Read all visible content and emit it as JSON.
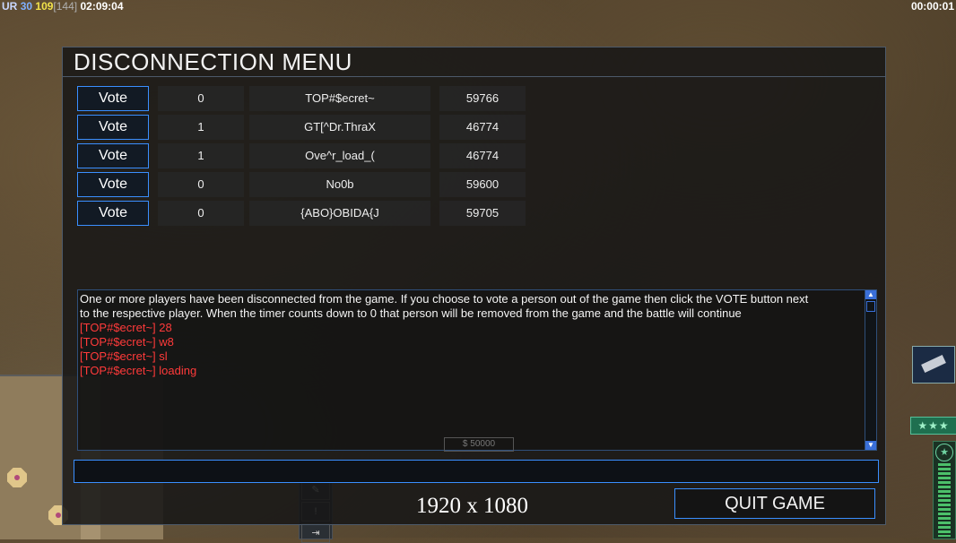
{
  "hud": {
    "ur_label": "UR",
    "value1": "30",
    "value2": "109",
    "value3": "[144]",
    "game_time": "02:09:04",
    "timer_right": "00:00:01"
  },
  "dialog": {
    "title": "DISCONNECTION MENU",
    "vote_label": "Vote",
    "players": [
      {
        "votes": "0",
        "name": "TOP#$ecret~",
        "ping": "59766"
      },
      {
        "votes": "1",
        "name": "GT[^Dr.ThraX",
        "ping": "46774"
      },
      {
        "votes": "1",
        "name": "Ove^r_load_(",
        "ping": "46774"
      },
      {
        "votes": "0",
        "name": "No0b",
        "ping": "59600"
      },
      {
        "votes": "0",
        "name": "{ABO}OBIDA{J",
        "ping": "59705"
      }
    ],
    "chat": {
      "system_line1": "One or more players have been disconnected from the game. If you choose to vote a person out of the game then click the VOTE button next",
      "system_line2": " to the respective player. When the timer counts down to 0 that person will be removed from the game and the battle will continue",
      "messages": [
        "[TOP#$ecret~] 28",
        "[TOP#$ecret~] w8",
        "[TOP#$ecret~] sl",
        "[TOP#$ecret~] loading"
      ]
    },
    "chat_input_value": "",
    "resolution_label": "1920 x 1080",
    "quit_label": "QUIT GAME"
  },
  "background": {
    "money_ghost": "$ 50000",
    "stars": "★★★"
  },
  "colors": {
    "accent": "#3a8fff",
    "chat_red": "#ff3a3a",
    "hud_yellow": "#f2e24a"
  }
}
